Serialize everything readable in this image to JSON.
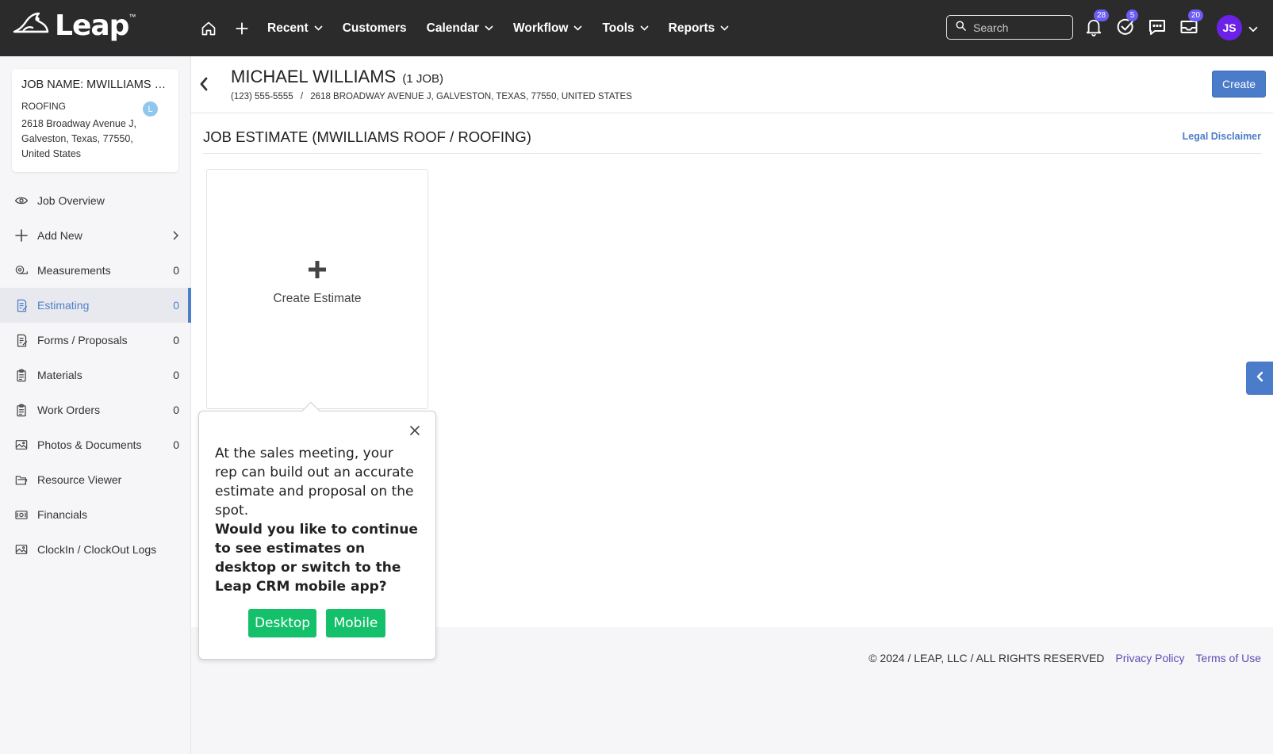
{
  "brand": {
    "name": "Leap",
    "trademark": "™"
  },
  "nav": {
    "items": [
      {
        "label": "Recent",
        "dropdown": true
      },
      {
        "label": "Customers",
        "dropdown": false
      },
      {
        "label": "Calendar",
        "dropdown": true
      },
      {
        "label": "Workflow",
        "dropdown": true
      },
      {
        "label": "Tools",
        "dropdown": true
      },
      {
        "label": "Reports",
        "dropdown": true
      }
    ],
    "search_placeholder": "Search",
    "notifications_count": "28",
    "tasks_count": "5",
    "messages_count": "20",
    "user_initials": "JS"
  },
  "job": {
    "name": "JOB NAME: MWILLIAMS ROOF",
    "trade": "ROOFING",
    "badge": "L",
    "address_line1": "2618 Broadway Avenue J,",
    "address_line2": "Galveston, Texas, 77550,",
    "address_line3": "United States"
  },
  "sidebar": {
    "items": [
      {
        "label": "Job Overview",
        "icon": "eye-icon",
        "count": ""
      },
      {
        "label": "Add New",
        "icon": "plus-icon",
        "count": ""
      },
      {
        "label": "Measurements",
        "icon": "measuring-tape-icon",
        "count": "0"
      },
      {
        "label": "Estimating",
        "icon": "estimate-icon",
        "count": "0"
      },
      {
        "label": "Forms / Proposals",
        "icon": "forms-icon",
        "count": "0"
      },
      {
        "label": "Materials",
        "icon": "clipboard-icon",
        "count": "0"
      },
      {
        "label": "Work Orders",
        "icon": "clipboard-icon",
        "count": "0"
      },
      {
        "label": "Photos & Documents",
        "icon": "image-icon",
        "count": "0"
      },
      {
        "label": "Resource Viewer",
        "icon": "folder-icon",
        "count": ""
      },
      {
        "label": "Financials",
        "icon": "money-icon",
        "count": ""
      },
      {
        "label": "ClockIn / ClockOut Logs",
        "icon": "image-icon",
        "count": ""
      }
    ]
  },
  "customer": {
    "name": "MICHAEL WILLIAMS",
    "jobs": "(1 JOB)",
    "phone": "(123) 555-5555",
    "separator": "/",
    "address": "2618 BROADWAY AVENUE J, GALVESTON, TEXAS, 77550, UNITED STATES",
    "create_label": "Create"
  },
  "estimate": {
    "title": "JOB ESTIMATE (MWILLIAMS ROOF / ROOFING)",
    "legal_label": "Legal Disclaimer",
    "create_label": "Create Estimate"
  },
  "popover": {
    "text": "At the sales meeting, your rep can build out an accurate estimate and proposal on the spot.",
    "question": "Would you like to continue to see estimates on desktop or switch to the Leap CRM mobile app?",
    "desktop_label": "Desktop",
    "mobile_label": "Mobile"
  },
  "footer": {
    "copyright": "© 2024 / LEAP, LLC / ALL RIGHTS RESERVED",
    "privacy": "Privacy Policy",
    "terms": "Terms of Use"
  },
  "colors": {
    "topbar": "#2b2b2b",
    "accent": "#4b7cc9",
    "badge": "#6b5cf6",
    "avatar": "#6b21e8",
    "cta_green": "#14c06a",
    "link_purple": "#5b4fb5"
  }
}
